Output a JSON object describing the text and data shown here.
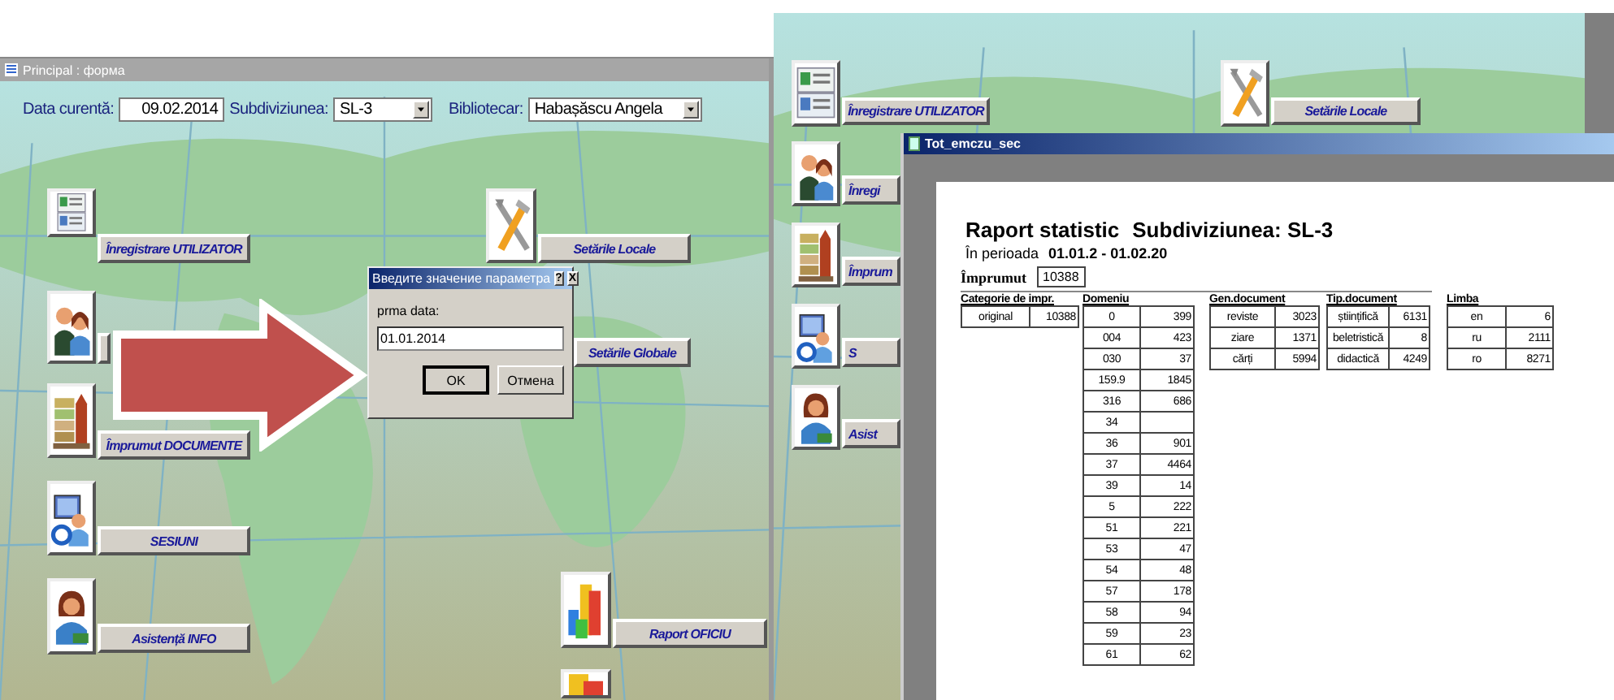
{
  "left_window": {
    "title": "Principal : форма",
    "header": {
      "date_label": "Data curentă:",
      "date_value": "09.02.2014",
      "subdivision_label": "Subdiviziunea:",
      "subdivision_value": "SL-3",
      "librarian_label": "Bibliotecar:",
      "librarian_value": "Habașăscu Angela"
    },
    "menu_buttons": [
      {
        "kind": "id-card",
        "label": "Înregistrare UTILIZATOR"
      },
      {
        "kind": "people"
      },
      {
        "kind": "books",
        "label": "Împrumut DOCUMENTE"
      },
      {
        "kind": "sessions",
        "label": "SESIUNI"
      },
      {
        "kind": "woman",
        "label": "Asistență INFO"
      },
      {
        "kind": "tools",
        "label": "Setările Locale"
      },
      {
        "kind": "none",
        "label": "Setările Globale"
      },
      {
        "kind": "chart",
        "label": "Raport OFICIU"
      },
      {
        "kind": "chart"
      }
    ],
    "dialog": {
      "title": "Введите значение параметра",
      "help": "?",
      "close": "X",
      "prompt": "prma data:",
      "value": "01.01.2014",
      "buttons": [
        "OK",
        "Отмена"
      ]
    }
  },
  "right_window": {
    "menu_buttons": [
      {
        "kind": "id-card",
        "label": "Înregistrare UTILIZATOR"
      },
      {
        "kind": "tools",
        "label": "Setările Locale"
      },
      {
        "kind": "people",
        "label": "Înregi"
      },
      {
        "kind": "books",
        "label": "Împrum"
      },
      {
        "kind": "sessions",
        "label": "S"
      },
      {
        "kind": "woman",
        "label": "Asist"
      }
    ],
    "report": {
      "title": "Tot_emczu_sec",
      "heading": "Raport statistic",
      "subdivision": "Subdiviziunea: SL-3",
      "period_label": "În perioada",
      "period_value": "01.01.2 - 01.02.20",
      "total_label": "Împrumut",
      "total_value": "10388",
      "groups": [
        {
          "title": "Categorie de impr.",
          "rows": [
            {
              "name": "original",
              "value": "10388"
            }
          ]
        },
        {
          "title": "Domeniu",
          "rows": [
            {
              "name": "0",
              "value": "399"
            },
            {
              "name": "004",
              "value": "423"
            },
            {
              "name": "030",
              "value": "37"
            },
            {
              "name": "159.9",
              "value": "1845"
            },
            {
              "name": "316",
              "value": "686"
            },
            {
              "name": "34"
            },
            {
              "name": "36",
              "value": "901"
            },
            {
              "name": "37",
              "value": "4464"
            },
            {
              "name": "39",
              "value": "14"
            },
            {
              "name": "5",
              "value": "222"
            },
            {
              "name": "51",
              "value": "221"
            },
            {
              "name": "53",
              "value": "47"
            },
            {
              "name": "54",
              "value": "48"
            },
            {
              "name": "57",
              "value": "178"
            },
            {
              "name": "58",
              "value": "94"
            },
            {
              "name": "59",
              "value": "23"
            },
            {
              "name": "61",
              "value": "62"
            }
          ]
        },
        {
          "title": "Gen.document",
          "rows": [
            {
              "name": "reviste",
              "value": "3023"
            },
            {
              "name": "ziare",
              "value": "1371"
            },
            {
              "name": "cărți",
              "value": "5994"
            }
          ]
        },
        {
          "title": "Tip.document",
          "rows": [
            {
              "name": "științifică",
              "value": "6131"
            },
            {
              "name": "beletristică",
              "value": "8"
            },
            {
              "name": "didactică",
              "value": "4249"
            }
          ]
        },
        {
          "title": "Limba",
          "rows": [
            {
              "name": "en",
              "value": "6"
            },
            {
              "name": "ru",
              "value": "2111"
            },
            {
              "name": "ro",
              "value": "8271"
            }
          ]
        }
      ]
    }
  }
}
